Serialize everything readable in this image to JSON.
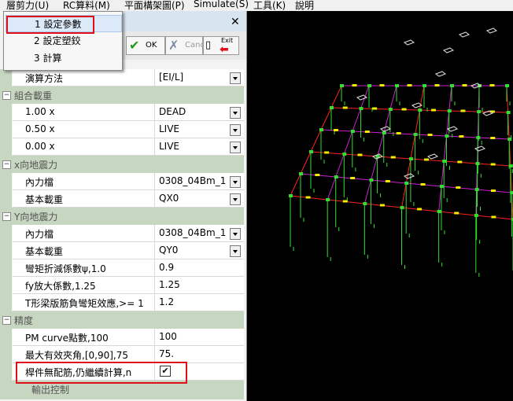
{
  "menubar": {
    "items": [
      "層剪力(U)",
      "RC算料(M)",
      "平面構架圖(P)",
      "Simulate(S)",
      "工具(K)",
      "說明"
    ]
  },
  "dropdown_menu": {
    "items": [
      "1 設定參數",
      "2 設定塑鉸",
      "3 計算"
    ],
    "selected_index": 0
  },
  "panel": {
    "close": "✕",
    "toolbar": {
      "ok": "OK",
      "cancel": "Cancel",
      "exit": "Exit"
    },
    "rows": [
      {
        "type": "prop",
        "name": "演算方法",
        "value": "[EI/L]",
        "dropdown": true
      },
      {
        "type": "section",
        "name": "組合載重"
      },
      {
        "type": "prop",
        "name": "1.00 x",
        "value": "DEAD",
        "dropdown": true
      },
      {
        "type": "prop",
        "name": "0.50 x",
        "value": "LIVE",
        "dropdown": true
      },
      {
        "type": "prop",
        "name": "0.00 x",
        "value": "LIVE",
        "dropdown": true
      },
      {
        "type": "section",
        "name": "x向地震力"
      },
      {
        "type": "prop",
        "name": "內力檔",
        "value": "0308_04Bm_1",
        "dropdown": true
      },
      {
        "type": "prop",
        "name": "基本載重",
        "value": "QX0",
        "dropdown": true
      },
      {
        "type": "section",
        "name": "Y向地震力"
      },
      {
        "type": "prop",
        "name": "內力檔",
        "value": "0308_04Bm_1",
        "dropdown": true
      },
      {
        "type": "prop",
        "name": "基本載重",
        "value": "QY0",
        "dropdown": true
      },
      {
        "type": "prop",
        "name": "彎矩折減係數ψ,1.0",
        "value": "0.9",
        "dropdown": false
      },
      {
        "type": "prop",
        "name": "fy放大係數,1.25",
        "value": "1.25",
        "dropdown": false
      },
      {
        "type": "prop",
        "name": "T形梁版筋負彎矩效應,>= 1",
        "value": "1.2",
        "dropdown": false
      },
      {
        "type": "section",
        "name": "精度"
      },
      {
        "type": "prop",
        "name": "PM curve點數,100",
        "value": "100",
        "dropdown": false
      },
      {
        "type": "prop",
        "name": "最大有效夾角,[0,90],75",
        "value": "75.",
        "dropdown": false
      },
      {
        "type": "check",
        "name": "桿件無配筋,仍繼續計算,n",
        "checked": true,
        "mark": "✔"
      },
      {
        "type": "section",
        "name": "輸出控制"
      }
    ]
  },
  "colors": {
    "accent_red": "#e0101a",
    "beam_magenta": "#d020d0",
    "beam_red": "#ff2020",
    "column_green": "#30e030",
    "label_yellow": "#f0f000"
  }
}
